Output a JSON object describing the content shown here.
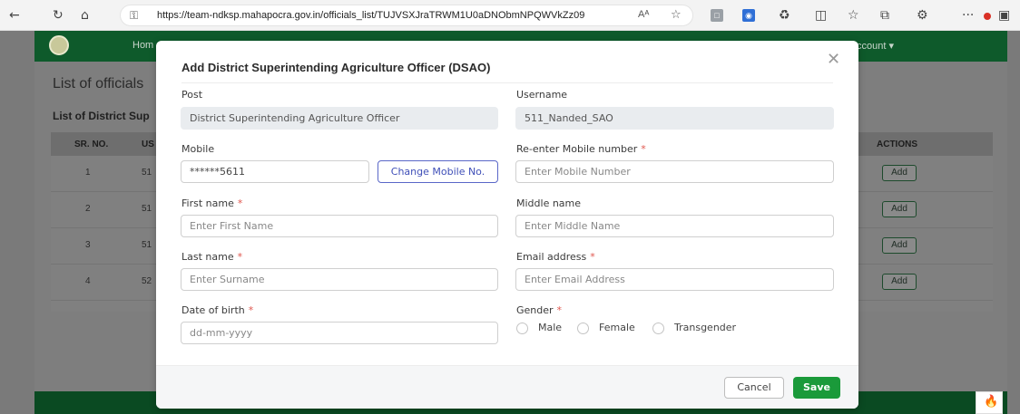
{
  "browser": {
    "url": "https://team-ndksp.mahapocra.gov.in/officials_list/TUJVSXJraTRWM1U0aDNObmNPQWVkZz09",
    "back_icon": "back-arrow-icon",
    "refresh_icon": "refresh-icon",
    "home_icon": "home-icon",
    "reader_label": "Aᴬ"
  },
  "app": {
    "nav_home": "Hom",
    "nav_account": "ccount ▾",
    "page_title": "List of officials",
    "section_title": "List of District Sup",
    "table": {
      "headers": {
        "sr": "SR. NO.",
        "us": "US",
        "actions": "ACTIONS"
      },
      "rows": [
        {
          "sr": "1",
          "us": "51",
          "action": "Add"
        },
        {
          "sr": "2",
          "us": "51",
          "action": "Add"
        },
        {
          "sr": "3",
          "us": "51",
          "action": "Add"
        },
        {
          "sr": "4",
          "us": "52",
          "action": "Add"
        }
      ]
    },
    "brand_color": "#0e5a2b"
  },
  "modal": {
    "title": "Add District Superintending Agriculture Officer (DSAO)",
    "close_icon": "close-icon",
    "post": {
      "label": "Post",
      "value": "District Superintending Agriculture Officer"
    },
    "username": {
      "label": "Username",
      "value": "511_Nanded_SAO"
    },
    "mobile": {
      "label": "Mobile",
      "value": "******5611",
      "change_button": "Change Mobile No."
    },
    "reenter_mobile": {
      "label": "Re-enter Mobile number",
      "required": "*",
      "placeholder": "Enter Mobile Number"
    },
    "first_name": {
      "label": "First name",
      "required": "*",
      "placeholder": "Enter First Name"
    },
    "middle_name": {
      "label": "Middle name",
      "placeholder": "Enter Middle Name"
    },
    "last_name": {
      "label": "Last name",
      "required": "*",
      "placeholder": "Enter Surname"
    },
    "email": {
      "label": "Email address",
      "required": "*",
      "placeholder": "Enter Email Address"
    },
    "dob": {
      "label": "Date of birth",
      "required": "*",
      "placeholder": "dd-mm-yyyy",
      "icon": "calendar-icon"
    },
    "gender": {
      "label": "Gender",
      "required": "*",
      "options": [
        "Male",
        "Female",
        "Transgender"
      ]
    },
    "cancel_label": "Cancel",
    "save_label": "Save",
    "save_color": "#1a9a3a",
    "required_color": "#e0574f"
  }
}
